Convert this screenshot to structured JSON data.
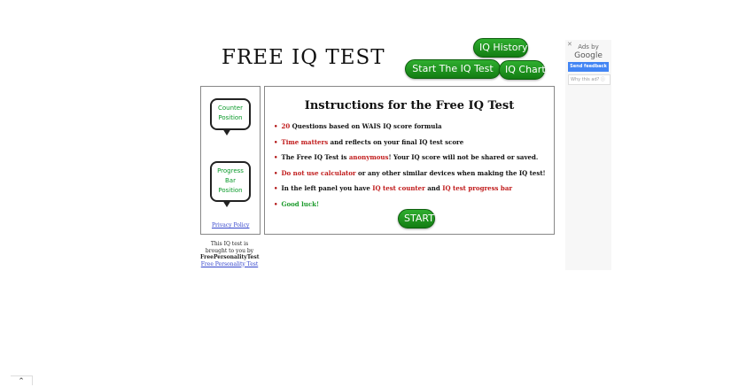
{
  "logo": "FREE IQ TEST",
  "nav": {
    "iq_history": "IQ History",
    "start_test": "Start The IQ Test",
    "iq_chart": "IQ Chart"
  },
  "left_panel": {
    "counter_line1": "Counter",
    "counter_line2": "Position",
    "progress_line1": "Progress",
    "progress_line2": "Bar",
    "progress_line3": "Position",
    "privacy_policy": "Privacy Policy"
  },
  "main": {
    "title": "Instructions for the Free IQ Test",
    "rules": {
      "r1_a": "20",
      "r1_b": " Questions based on WAIS IQ score formula",
      "r2_a": "Time matters",
      "r2_b": " and reflects on your final IQ test score",
      "r3_a": "The Free IQ Test is ",
      "r3_b": "anonymous",
      "r3_c": "! Your IQ score will not be shared or saved.",
      "r4_a": "Do not use calculator",
      "r4_b": " or any other similar devices when making the IQ test!",
      "r5_a": "In the left panel you have ",
      "r5_b": "IQ test counter",
      "r5_c": " and ",
      "r5_d": "IQ test progress bar",
      "r6": "Good luck!"
    },
    "start_label": "START"
  },
  "credit": {
    "line1": "This IQ test is",
    "line2": "brought to you by",
    "brand": "FreePersonalityTest",
    "link": "Free Personality Test"
  },
  "ad": {
    "ads_by": "Ads by",
    "google": "Google",
    "send_feedback": "Send feedback",
    "why_this_ad": "Why this ad? ⓘ"
  },
  "scroll_icon": "chevron-up-icon",
  "colors": {
    "button_green": "#1f951f",
    "highlight_red": "#c01a1a",
    "good_luck_green": "#1a9a2a"
  }
}
